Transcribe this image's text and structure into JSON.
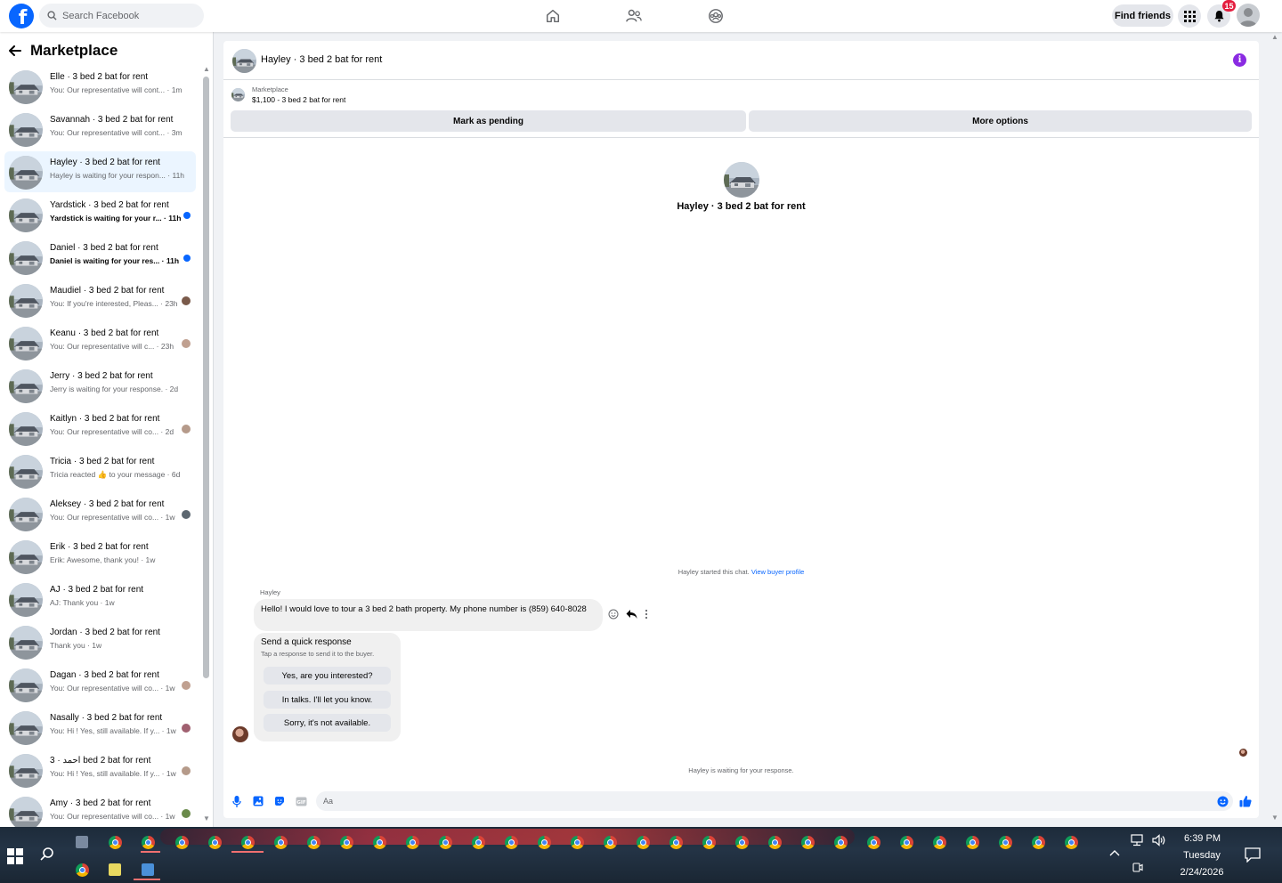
{
  "topbar": {
    "logo_letter": "f",
    "search_placeholder": "Search Facebook",
    "find_friends": "Find friends",
    "notification_count": "15",
    "brand_color": "#0866ff"
  },
  "sidebar": {
    "title": "Marketplace",
    "conversations": [
      {
        "name": "Elle · 3 bed 2 bat for rent",
        "preview": "You: Our representative will cont... · 1m",
        "status": "none"
      },
      {
        "name": "Savannah · 3 bed 2 bat for rent",
        "preview": "You: Our representative will cont... · 3m",
        "status": "none"
      },
      {
        "name": "Hayley · 3 bed 2 bat for rent",
        "preview": "Hayley is waiting for your respon... · 11h",
        "status": "none",
        "active": true
      },
      {
        "name": "Yardstick · 3 bed 2 bat for rent",
        "preview": "Yardstick is waiting for your r... · 11h",
        "status": "unread"
      },
      {
        "name": "Daniel · 3 bed 2 bat for rent",
        "preview": "Daniel is waiting for your res... · 11h",
        "status": "unread"
      },
      {
        "name": "Maudiel · 3 bed 2 bat for rent",
        "preview": "You: If you're interested, Pleas... · 23h",
        "status": "seen"
      },
      {
        "name": "Keanu · 3 bed 2 bat for rent",
        "preview": "You: Our representative will c... · 23h",
        "status": "seen"
      },
      {
        "name": "Jerry · 3 bed 2 bat for rent",
        "preview": "Jerry is waiting for your response. · 2d",
        "status": "none"
      },
      {
        "name": "Kaitlyn · 3 bed 2 bat for rent",
        "preview": "You: Our representative will co... · 2d",
        "status": "seen"
      },
      {
        "name": "Tricia · 3 bed 2 bat for rent",
        "preview": "Tricia reacted 👍 to your message · 6d",
        "status": "none"
      },
      {
        "name": "Aleksey · 3 bed 2 bat for rent",
        "preview": "You: Our representative will co... · 1w",
        "status": "seen"
      },
      {
        "name": "Erik · 3 bed 2 bat for rent",
        "preview": "Erik: Awesome, thank you! · 1w",
        "status": "none"
      },
      {
        "name": "AJ · 3 bed 2 bat for rent",
        "preview": "AJ: Thank you · 1w",
        "status": "none"
      },
      {
        "name": "Jordan · 3 bed 2 bat for rent",
        "preview": "Thank you · 1w",
        "status": "none"
      },
      {
        "name": "Dagan · 3 bed 2 bat for rent",
        "preview": "You: Our representative will co... · 1w",
        "status": "seen"
      },
      {
        "name": "Nasally · 3 bed 2 bat for rent",
        "preview": "You: Hi ! Yes, still available. If y... · 1w",
        "status": "seen"
      },
      {
        "name": "احمد · 3 bed 2 bat for rent",
        "preview": "You: Hi ! Yes, still available. If y... · 1w",
        "status": "seen"
      },
      {
        "name": "Amy · 3 bed 2 bat for rent",
        "preview": "You: Our representative will co... · 1w",
        "status": "seen"
      }
    ]
  },
  "chat": {
    "title": "Hayley · 3 bed 2 bat for rent",
    "marketplace_label": "Marketplace",
    "listing": "$1,100 - 3 bed 2 bat for rent",
    "mark_pending": "Mark as pending",
    "more_options": "More options",
    "center_name": "Hayley · 3 bed 2 bat for rent",
    "started_text": "Hayley started this chat.",
    "view_buyer_profile": "View buyer profile",
    "sender": "Hayley",
    "message": "Hello! I would love to tour a 3 bed 2 bath property. My phone number is (859) 640-8028",
    "quick_title": "Send a quick response",
    "quick_sub": "Tap a response to send it to the buyer.",
    "quick_responses": [
      "Yes, are you interested?",
      "In talks. I'll let you know.",
      "Sorry, it's not available."
    ],
    "waiting": "Hayley is waiting for your response.",
    "compose_placeholder": "Aa",
    "info_color": "#8a2be2"
  },
  "taskbar": {
    "time": "6:39 PM",
    "day": "Tuesday",
    "date": "2/24/2026"
  }
}
